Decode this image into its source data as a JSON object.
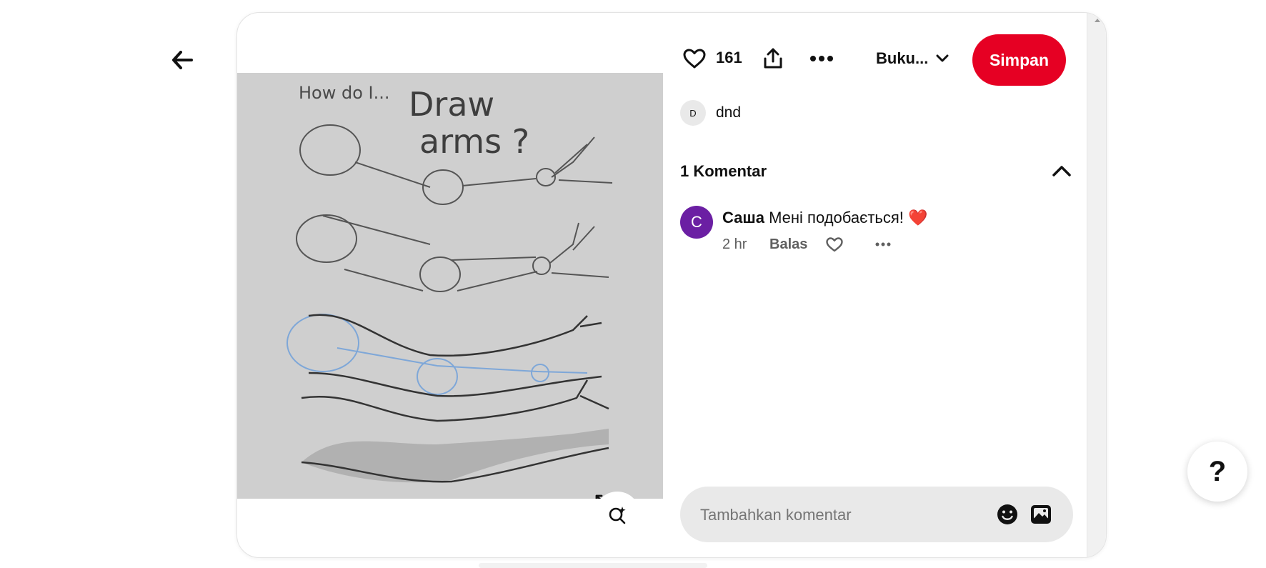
{
  "nav": {
    "back_icon": "arrow-left-icon"
  },
  "pin": {
    "image_description_icon": "pin-image",
    "expand_icon": "expand-icon",
    "visual_search_icon": "visual-search-icon",
    "sketch_text": {
      "line1": "How do I...",
      "line2": "Draw",
      "line3": "arms ?"
    }
  },
  "actions": {
    "like_count": "161",
    "board_label": "Buku...",
    "save_label": "Simpan",
    "icons": {
      "like": "heart-icon",
      "share": "share-icon",
      "more": "more-icon",
      "dropdown": "chevron-down-icon"
    }
  },
  "board": {
    "avatar_letter": "D",
    "name": "dnd"
  },
  "comments": {
    "title": "1 Komentar",
    "items": [
      {
        "avatar_letter": "C",
        "author": "Саша",
        "text": "Мені подобається! ❤️",
        "time": "2 hr",
        "reply_label": "Balas"
      }
    ]
  },
  "comment_input": {
    "placeholder": "Tambahkan komentar"
  },
  "help": {
    "label": "?"
  },
  "colors": {
    "save": "#e60023",
    "avatar_comment": "#6b1fa3",
    "image_bg": "#cfcfcf"
  }
}
